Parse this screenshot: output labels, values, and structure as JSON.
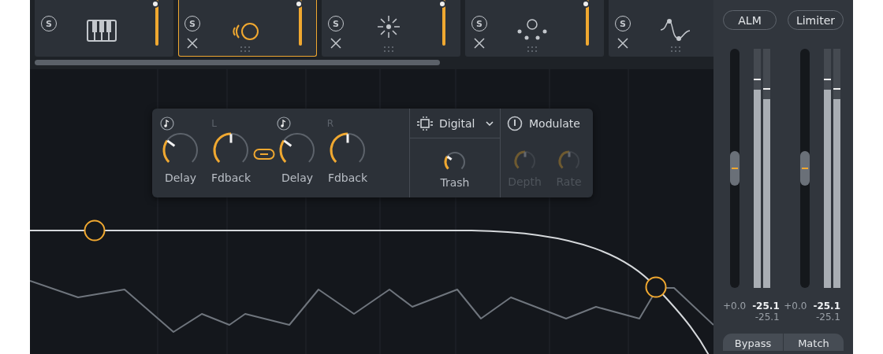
{
  "modules": [
    {
      "solo": "S",
      "selected": false,
      "removable": false,
      "level": 1
    },
    {
      "solo": "S",
      "selected": true,
      "removable": true,
      "level": 1
    },
    {
      "solo": "S",
      "selected": false,
      "removable": true,
      "level": 1
    },
    {
      "solo": "S",
      "selected": false,
      "removable": true,
      "level": 1
    },
    {
      "solo": "S",
      "selected": false,
      "removable": true
    }
  ],
  "delay_panel": {
    "linked": true,
    "channels": [
      {
        "label": "L",
        "knobs": [
          {
            "label": "Delay",
            "level": 0.3
          },
          {
            "label": "Fdback",
            "level": 0.5
          }
        ]
      },
      {
        "label": "R",
        "knobs": [
          {
            "label": "Delay",
            "level": 0.3
          },
          {
            "label": "Fdback",
            "level": 0.5
          }
        ]
      }
    ],
    "mode": {
      "value": "Digital",
      "knob": {
        "label": "Trash",
        "level": 0.3
      }
    },
    "modulate": {
      "label": "Modulate",
      "on": false,
      "knobs": [
        {
          "label": "Depth",
          "level": 0.5
        },
        {
          "label": "Rate",
          "level": 0.5
        }
      ]
    }
  },
  "right_panel": {
    "buttons": [
      {
        "label": "ALM"
      },
      {
        "label": "Limiter"
      }
    ],
    "channels": [
      {
        "fader": {
          "level": 0.5
        },
        "meters": [
          {
            "level": 0.83
          },
          {
            "level": 0.79
          }
        ],
        "gain": "+0.0",
        "readings": [
          "-25.1",
          "-25.1"
        ]
      },
      {
        "fader": {
          "level": 0.5
        },
        "meters": [
          {
            "level": 0.83
          },
          {
            "level": 0.79
          }
        ],
        "gain": "+0.0",
        "readings": [
          "-25.1",
          "-25.1"
        ]
      }
    ],
    "footer_buttons": [
      {
        "label": "Bypass"
      },
      {
        "label": "Match"
      }
    ]
  }
}
